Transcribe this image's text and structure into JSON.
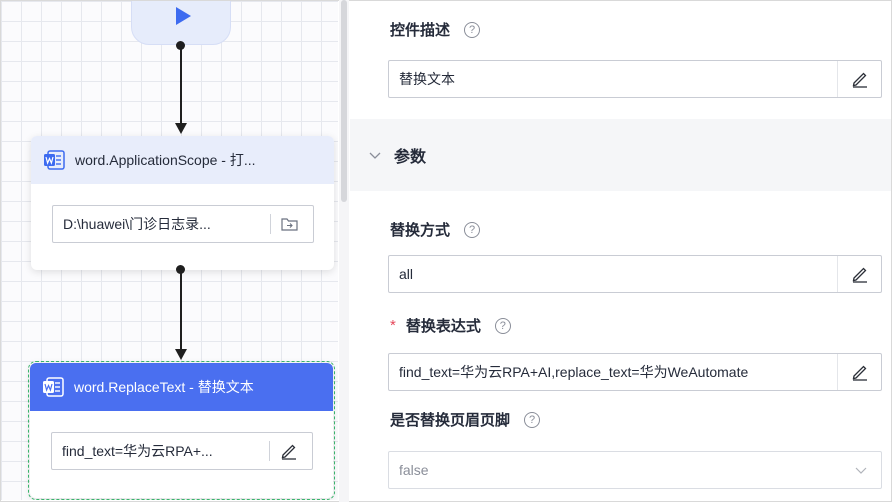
{
  "canvas": {
    "node1": {
      "title": "word.ApplicationScope - 打...",
      "field_value": "D:\\huawei\\门诊日志录..."
    },
    "node2": {
      "title": "word.ReplaceText - 替换文本",
      "field_value": "find_text=华为云RPA+..."
    }
  },
  "properties": {
    "description": {
      "label": "控件描述",
      "value": "替换文本"
    },
    "section": {
      "title": "参数"
    },
    "replace_mode": {
      "label": "替换方式",
      "value": "all"
    },
    "replace_expr": {
      "required_mark": "*",
      "label": "替换表达式",
      "value": "find_text=华为云RPA+AI,replace_text=华为WeAutomate"
    },
    "replace_header_footer": {
      "label": "是否替换页眉页脚",
      "value": "false"
    },
    "help_glyph": "?"
  },
  "colors": {
    "accent": "#4a6ff0",
    "node_header_light": "#e8edfb",
    "selected_outline": "#3ab46b",
    "required": "#e5475a"
  },
  "icons": [
    "play-icon",
    "word-icon",
    "folder-icon",
    "edit-icon",
    "chevron-down-icon",
    "help-icon"
  ]
}
